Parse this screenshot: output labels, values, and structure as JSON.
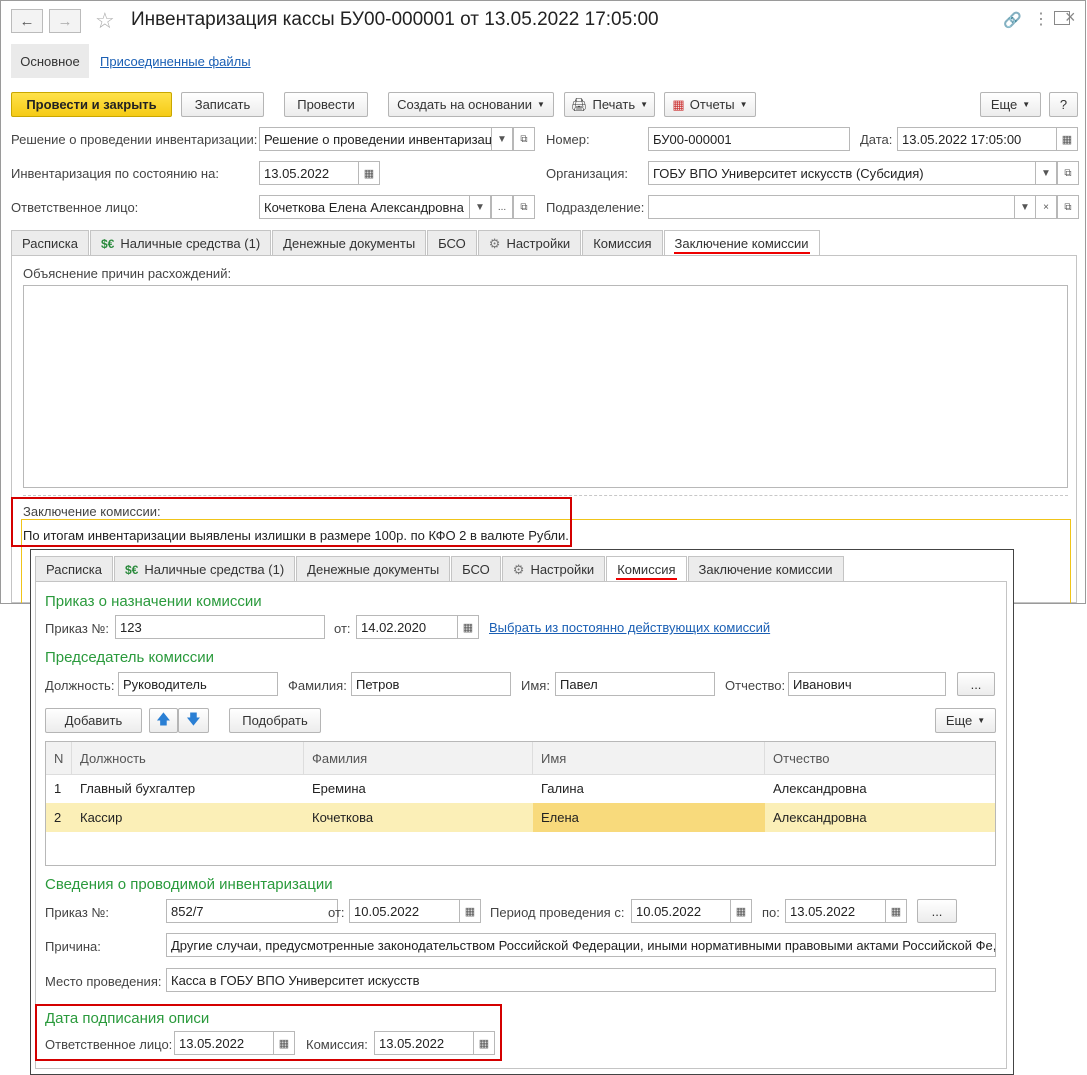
{
  "window": {
    "title": "Инвентаризация кассы БУ00-000001 от 13.05.2022 17:05:00",
    "nav_tabs": [
      "Основное",
      "Присоединенные файлы"
    ]
  },
  "toolbar": {
    "post_close": "Провести и закрыть",
    "save": "Записать",
    "post": "Провести",
    "create_based": "Создать на основании",
    "print": "Печать",
    "reports": "Отчеты",
    "more": "Еще",
    "help": "?"
  },
  "header": {
    "decision_label": "Решение о проведении инвентаризации:",
    "decision_value": "Решение о проведении инвентаризац",
    "number_label": "Номер:",
    "number_value": "БУ00-000001",
    "date_label": "Дата:",
    "date_value": "13.05.2022 17:05:00",
    "state_label": "Инвентаризация по состоянию на:",
    "state_value": "13.05.2022",
    "org_label": "Организация:",
    "org_value": "ГОБУ ВПО Университет искусств (Субсидия)",
    "resp_label": "Ответственное лицо:",
    "resp_value": "Кочеткова Елена Александровна",
    "dept_label": "Подразделение:",
    "dept_value": ""
  },
  "tabs1": [
    "Расписка",
    "Наличные средства (1)",
    "Денежные документы",
    "БСО",
    "Настройки",
    "Комиссия",
    "Заключение комиссии"
  ],
  "conclusion": {
    "explain_label": "Объяснение причин расхождений:",
    "conclusion_label": "Заключение комиссии:",
    "conclusion_text": "По итогам инвентаризации выявлены излишки в размере 100р. по КФО 2 в валюте Рубли."
  },
  "tabs2": [
    "Расписка",
    "Наличные средства (1)",
    "Денежные документы",
    "БСО",
    "Настройки",
    "Комиссия",
    "Заключение комиссии"
  ],
  "commission": {
    "order_section": "Приказ о назначении комиссии",
    "order_label": "Приказ №:",
    "order_value": "123",
    "from_label": "от:",
    "from_value": "14.02.2020",
    "choose_link": "Выбрать из постоянно действующих комиссий",
    "chair_section": "Председатель комиссии",
    "position_label": "Должность:",
    "position_value": "Руководитель",
    "surname_label": "Фамилия:",
    "surname_value": "Петров",
    "name_label": "Имя:",
    "name_value": "Павел",
    "patronymic_label": "Отчество:",
    "patronymic_value": "Иванович",
    "dots": "...",
    "add_btn": "Добавить",
    "pick_btn": "Подобрать",
    "more_btn": "Еще",
    "columns": [
      "N",
      "Должность",
      "Фамилия",
      "Имя",
      "Отчество"
    ],
    "rows": [
      [
        "1",
        "Главный бухгалтер",
        "Еремина",
        "Галина",
        "Александровна"
      ],
      [
        "2",
        "Кассир",
        "Кочеткова",
        "Елена",
        "Александровна"
      ]
    ],
    "info_section": "Сведения о проводимой инвентаризации",
    "inv_order_label": "Приказ №:",
    "inv_order_value": "852/7",
    "inv_from_label": "от:",
    "inv_from_value": "10.05.2022",
    "period_label": "Период проведения с:",
    "period_from": "10.05.2022",
    "period_to_label": "по:",
    "period_to": "13.05.2022",
    "reason_label": "Причина:",
    "reason_value": "Другие случаи, предусмотренные законодательством Российской Федерации, иными нормативными правовыми актами Российской Фе,",
    "place_label": "Место проведения:",
    "place_value": "Касса в ГОБУ ВПО Университет искусств",
    "sign_section": "Дата подписания описи",
    "sign_resp_label": "Ответственное лицо:",
    "sign_resp_value": "13.05.2022",
    "sign_comm_label": "Комиссия:",
    "sign_comm_value": "13.05.2022"
  },
  "colors": {
    "accent": "#f5cb16",
    "green": "#2a9a3c",
    "link": "#1a5fb4",
    "highlight": "#d40000"
  }
}
